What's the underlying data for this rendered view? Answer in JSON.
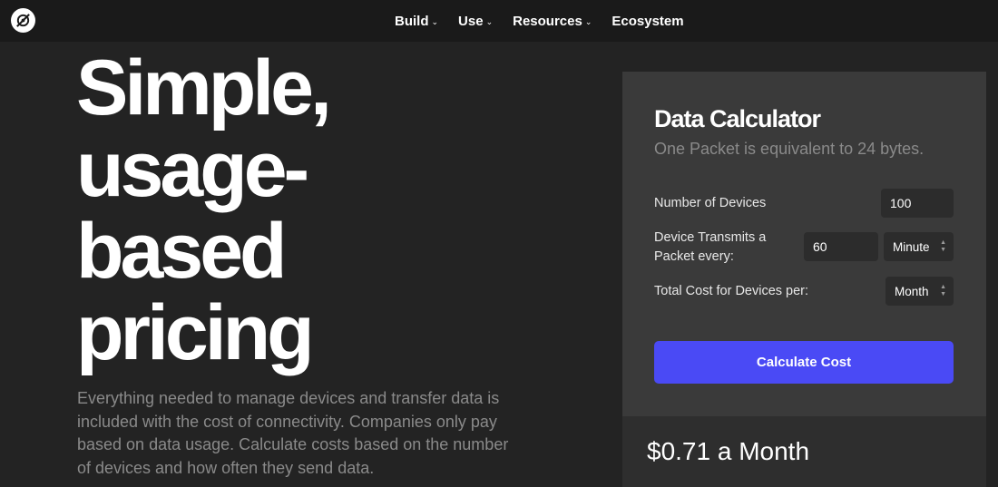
{
  "nav": {
    "logo_icon": "helium-logo-icon",
    "items": [
      {
        "label": "Build",
        "has_dropdown": true
      },
      {
        "label": "Use",
        "has_dropdown": true
      },
      {
        "label": "Resources",
        "has_dropdown": true
      },
      {
        "label": "Ecosystem",
        "has_dropdown": false
      }
    ]
  },
  "hero": {
    "title_lines": [
      "Simple,",
      "usage-",
      "based",
      "pricing"
    ],
    "description": "Everything needed to manage devices and transfer data is included with the cost of connectivity. Companies only pay based on data usage. Calculate costs based on the number of devices and how often they send data."
  },
  "calculator": {
    "title": "Data Calculator",
    "subtitle": "One Packet is equivalent to 24 bytes.",
    "devices_label": "Number of Devices",
    "devices_value": "100",
    "transmit_label_line1": "Device Transmits a",
    "transmit_label_line2": "Packet every:",
    "transmit_value": "60",
    "transmit_unit": "Minute",
    "cost_period_label": "Total Cost for Devices per:",
    "cost_period": "Month",
    "button_label": "Calculate Cost",
    "result": "$0.71 a Month"
  },
  "colors": {
    "background": "#232323",
    "nav_background": "#1a1a1a",
    "panel": "#3a3a3a",
    "accent_button": "#4a4af5"
  }
}
